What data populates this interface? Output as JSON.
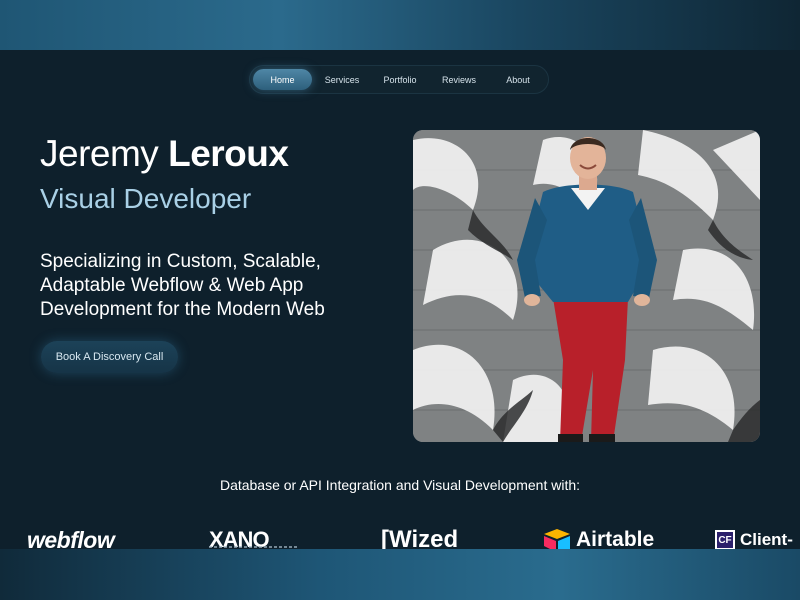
{
  "nav": {
    "items": [
      {
        "label": "Home",
        "active": true
      },
      {
        "label": "Services",
        "active": false
      },
      {
        "label": "Portfolio",
        "active": false
      },
      {
        "label": "Reviews",
        "active": false
      },
      {
        "label": "About",
        "active": false
      }
    ]
  },
  "hero": {
    "first_name": "Jeremy",
    "last_name": "Leroux",
    "role": "Visual Developer",
    "tagline": "Specializing in Custom, Scalable, Adaptable Webflow & Web App Development for the Modern Web",
    "cta_label": "Book A Discovery Call"
  },
  "integrations": {
    "heading": "Database or API Integration and Visual Development with:",
    "logos": [
      {
        "label": "webflow"
      },
      {
        "label": "XANO"
      },
      {
        "label": "Wized"
      },
      {
        "label": "Airtable"
      },
      {
        "label": "Client-"
      }
    ]
  },
  "colors": {
    "background": "#0e202c",
    "accent": "#a9d0e6",
    "nav_active": "#3e7493",
    "cta_bg": "#1c4258"
  }
}
